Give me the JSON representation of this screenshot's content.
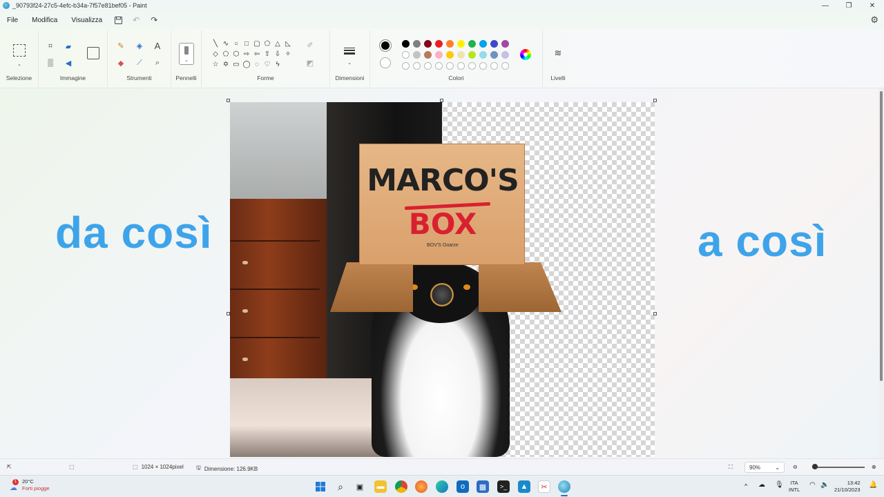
{
  "window": {
    "title": "_90793f24-27c5-4efc-b34a-7f57e81bef05 - Paint",
    "controls": [
      "—",
      "❐",
      "✕"
    ]
  },
  "menu": {
    "items": [
      "File",
      "Modifica",
      "Visualizza"
    ]
  },
  "ribbon": {
    "groups": {
      "selection": "Selezione",
      "image": "Immagine",
      "tools": "Strumenti",
      "brushes": "Pennelli",
      "shapes": "Forme",
      "size": "Dimensioni",
      "colors": "Colori",
      "layers": "Livelli"
    },
    "primary_color": "#000000",
    "secondary_color": "#ffffff",
    "palette_row1": [
      "#000000",
      "#7f7f7f",
      "#880015",
      "#ed1c24",
      "#ff7f27",
      "#fff200",
      "#22b14c",
      "#00a2e8",
      "#3f48cc",
      "#a349a4"
    ],
    "palette_row2": [
      "#ffffff",
      "#c3c3c3",
      "#b97a57",
      "#ffaec9",
      "#ffc90e",
      "#efe4b0",
      "#b5e61d",
      "#99d9ea",
      "#7092be",
      "#c8bfe7"
    ]
  },
  "canvas": {
    "left_text": "da così",
    "right_text": "a così",
    "box_title": "MARCO'S",
    "box_sub": "BOX",
    "box_small": "BOV'S Ooarze"
  },
  "status": {
    "dimensions": "1024 × 1024pixel",
    "filesize": "Dimensione: 126.9KB",
    "zoom": "90%"
  },
  "taskbar": {
    "weather_temp": "20°C",
    "weather_desc": "Forti piogge",
    "weather_badge": "1",
    "lang_top": "ITA",
    "lang_bottom": "INTL",
    "time": "13:42",
    "date": "21/10/2023"
  }
}
